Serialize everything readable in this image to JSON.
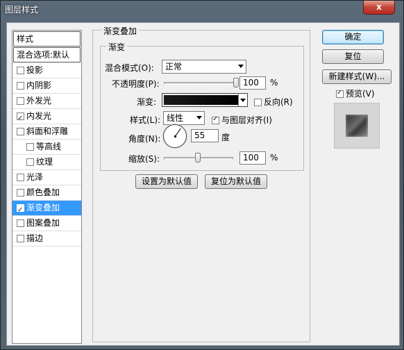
{
  "window": {
    "title": "图层样式",
    "close": "x"
  },
  "sidebar": {
    "header": "样式",
    "blend_default": "混合选项:默认",
    "items": [
      {
        "label": "投影",
        "checked": false
      },
      {
        "label": "内阴影",
        "checked": false
      },
      {
        "label": "外发光",
        "checked": false
      },
      {
        "label": "内发光",
        "checked": true
      },
      {
        "label": "斜面和浮雕",
        "checked": false
      },
      {
        "label": "等高线",
        "checked": false,
        "sub": true
      },
      {
        "label": "纹理",
        "checked": false,
        "sub": true
      },
      {
        "label": "光泽",
        "checked": false
      },
      {
        "label": "颜色叠加",
        "checked": false
      },
      {
        "label": "渐变叠加",
        "checked": true,
        "selected": true
      },
      {
        "label": "图案叠加",
        "checked": false
      },
      {
        "label": "描边",
        "checked": false
      }
    ]
  },
  "panel": {
    "section_title": "渐变叠加",
    "group_title": "渐变",
    "blend_mode_label": "混合模式(O):",
    "blend_mode_value": "正常",
    "opacity_label": "不透明度(P):",
    "opacity_value": "100",
    "opacity_unit": "%",
    "opacity_level": 1.0,
    "gradient_label": "渐变:",
    "reverse_label": "反向(R)",
    "reverse_checked": false,
    "style_label": "样式(L):",
    "style_value": "线性",
    "align_label": "与图层对齐(I)",
    "align_checked": true,
    "angle_label": "角度(N):",
    "angle_value": "55",
    "angle_unit": "度",
    "scale_label": "缩放(S):",
    "scale_value": "100",
    "scale_unit": "%",
    "scale_level": 0.5,
    "set_default_label": "设置为默认值",
    "reset_default_label": "复位为默认值"
  },
  "actions": {
    "ok_label": "确定",
    "reset_label": "复位",
    "new_style_label": "新建样式(W)...",
    "preview_label": "预览(V)",
    "preview_checked": true
  },
  "colors": {
    "selection": "#3399ff",
    "titlebar": "#4a5866",
    "close": "#c5443a"
  }
}
